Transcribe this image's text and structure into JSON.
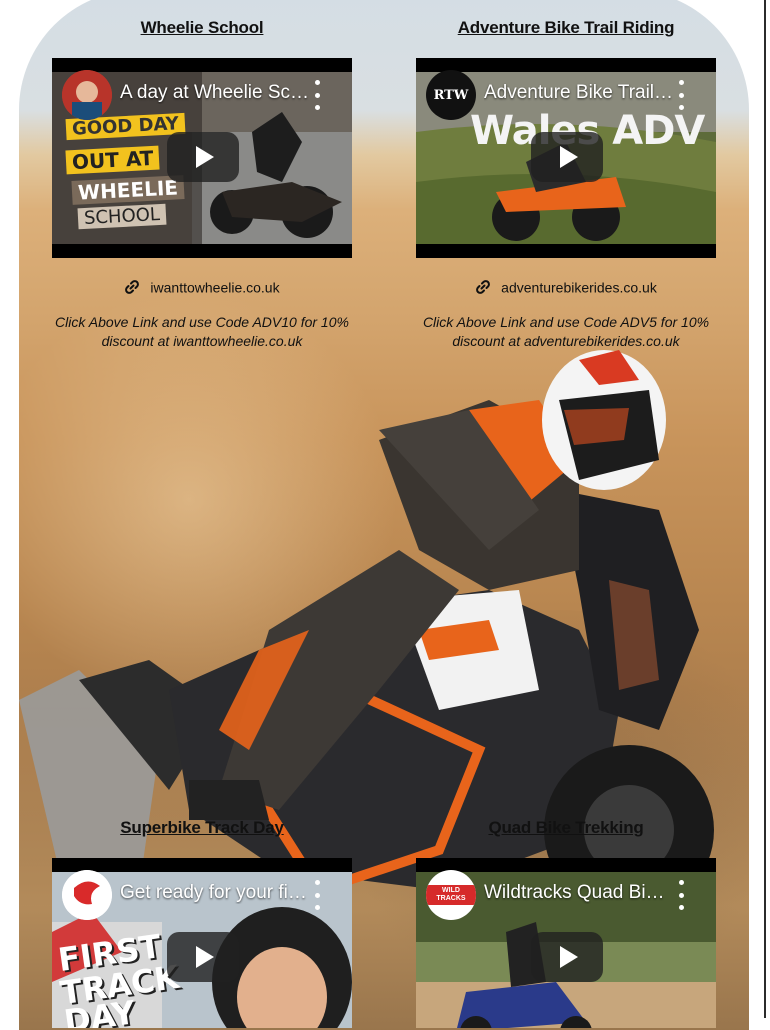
{
  "cards": [
    {
      "title": "Wheelie School",
      "video_title": "A day at Wheelie School",
      "channel_icon": "wheelie-school-avatar",
      "thumb_lines": [
        "GOOD DAY",
        "OUT AT",
        "WHEELIE",
        "SCHOOL"
      ],
      "link_text": "iwanttowheelie.co.uk",
      "promo": "Click Above Link and use Code ADV10 for 10% discount at iwanttowheelie.co.uk"
    },
    {
      "title": "Adventure Bike Trail Riding",
      "video_title": "Adventure Bike Trail Riding",
      "channel_icon": "rtw-avatar",
      "channel_initials": "RTW",
      "thumb_lines": [
        "Wales ADV"
      ],
      "link_text": "adventurebikerides.co.uk",
      "promo": "Click Above Link and use Code ADV5 for 10% discount at adventurebikerides.co.uk"
    },
    {
      "title": "Superbike Track Day",
      "video_title": "Get ready for your first track day",
      "channel_icon": "track-day-avatar",
      "thumb_lines": [
        "FIRST",
        "TRACK",
        "DAY"
      ]
    },
    {
      "title": "Quad Bike Trekking",
      "video_title": "Wildtracks Quad Bike Trekking",
      "channel_icon": "wildtracks-avatar",
      "channel_initials": "WILD TRACKS"
    }
  ],
  "colors": {
    "accent_orange": "#e8641b",
    "sky": "#d4dde4",
    "sand": "#d3a46d"
  }
}
